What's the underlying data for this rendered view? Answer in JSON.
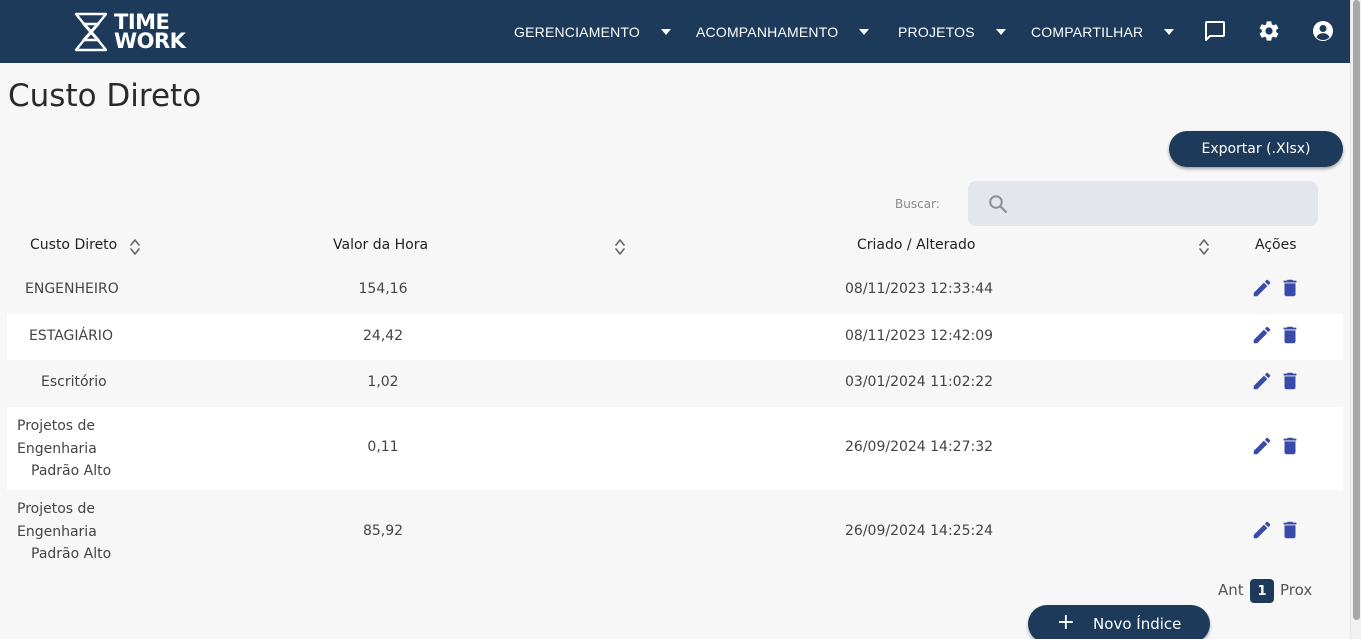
{
  "header": {
    "logo_line1": "TIME",
    "logo_line2": "WORK",
    "nav": [
      {
        "label": "GERENCIAMENTO"
      },
      {
        "label": "ACOMPANHAMENTO"
      },
      {
        "label": "PROJETOS"
      },
      {
        "label": "COMPARTILHAR"
      }
    ],
    "icons": [
      "chat-icon",
      "gear-icon",
      "account-icon"
    ],
    "color": "#1d3a5a"
  },
  "page": {
    "title": "Custo Direto",
    "export_label": "Exportar (.Xlsx)",
    "search_label": "Buscar:",
    "search_value": ""
  },
  "table": {
    "columns": [
      "Custo Direto",
      "Valor da Hora",
      "Criado / Alterado",
      "Ações"
    ],
    "rows": [
      {
        "name": "ENGENHEIRO",
        "value": "154,16",
        "date": "08/11/2023 12:33:44"
      },
      {
        "name": "ESTAGIÁRIO",
        "value": "24,42",
        "date": "08/11/2023 12:42:09"
      },
      {
        "name": "Escritório",
        "value": "1,02",
        "date": "03/01/2024 11:02:22"
      },
      {
        "name_lines": [
          "Projetos de",
          "Engenharia",
          "Padrão Alto"
        ],
        "value": "0,11",
        "date": "26/09/2024 14:27:32"
      },
      {
        "name_lines": [
          "Projetos de",
          "Engenharia",
          "Padrão Alto"
        ],
        "value": "85,92",
        "date": "26/09/2024 14:25:24"
      }
    ],
    "action_color": "#3a4aa8"
  },
  "pagination": {
    "prev": "Ant",
    "current": "1",
    "next": "Prox"
  },
  "new_button": {
    "plus": "+",
    "label": "Novo Índice"
  }
}
